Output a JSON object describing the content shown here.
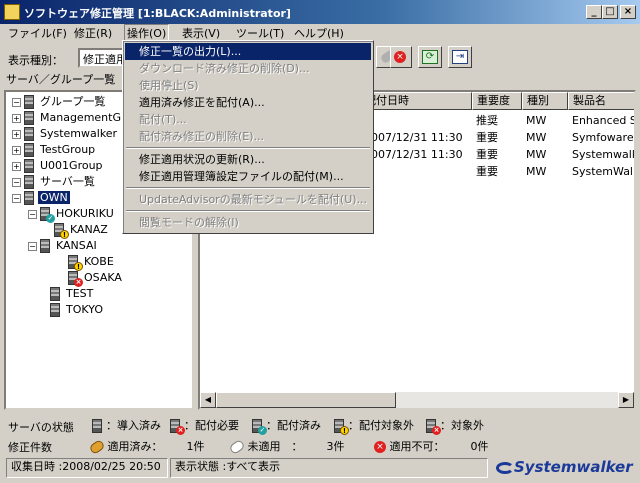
{
  "window": {
    "title": "ソフトウェア修正管理 [1:BLACK:Administrator]"
  },
  "menu": [
    "ファイル(F)",
    "修正(R)",
    "操作(O)",
    "表示(V)",
    "ツール(T)",
    "ヘルプ(H)"
  ],
  "toolbar": {
    "filter_label": "表示種別：",
    "filter_value": "修正適用"
  },
  "tree": {
    "label": "サーバ／グループ一覧",
    "rows": [
      "グループ一覧",
      "ManagementGr",
      "Systemwalker",
      "TestGroup",
      "U001Group",
      "サーバ一覧",
      "OWN",
      "HOKURIKU",
      "KANAZ",
      "KANSAI",
      "KOBE",
      "OSAKA",
      "TEST",
      "TOKYO"
    ]
  },
  "list": {
    "headers": [
      "配付日時",
      "重要度",
      "種別",
      "製品名"
    ],
    "rows": [
      [
        "",
        "推奨",
        "MW",
        "Enhanced S"
      ],
      [
        "2007/12/31 11:30",
        "重要",
        "MW",
        "Symfoware"
      ],
      [
        "2007/12/31 11:30",
        "重要",
        "MW",
        "Systemwalk"
      ],
      [
        "",
        "重要",
        "MW",
        "SystemWall"
      ]
    ]
  },
  "dropdown": [
    {
      "label": "修正一覧の出力(L)...",
      "state": "highlighted"
    },
    {
      "label": "ダウンロード済み修正の削除(D)...",
      "state": "disabled"
    },
    {
      "label": "使用停止(S)",
      "state": "disabled"
    },
    {
      "label": "適用済み修正を配付(A)...",
      "state": "enabled"
    },
    {
      "label": "配付(T)...",
      "state": "disabled"
    },
    {
      "label": "配付済み修正の削除(E)...",
      "state": "disabled"
    },
    {
      "label": "修正適用状況の更新(R)...",
      "state": "enabled"
    },
    {
      "label": "修正適用管理簿設定ファイルの配付(M)...",
      "state": "enabled"
    },
    {
      "label": "UpdateAdvisorの最新モジュールを配付(U)...",
      "state": "disabled"
    },
    {
      "label": "閲覧モードの解除(I)",
      "state": "disabled"
    }
  ],
  "legend": {
    "server_label": "サーバの状態",
    "items": [
      "：導入済み",
      "：配付必要",
      "：配付済み",
      "：配付対象外",
      "：対象外"
    ],
    "fix_label": "修正件数",
    "applied": "適用済み：",
    "applied_count": "1件",
    "unapplied": "未適用　：",
    "unapplied_count": "3件",
    "impossible": "適用不可：",
    "impossible_count": "0件"
  },
  "status": {
    "collected": "収集日時 :2008/02/25 20:50",
    "display": "表示状態 :すべて表示",
    "brand": "Systemwalker"
  },
  "colors": {
    "selection": "#0a246a",
    "brand": "#1a3a9a"
  }
}
